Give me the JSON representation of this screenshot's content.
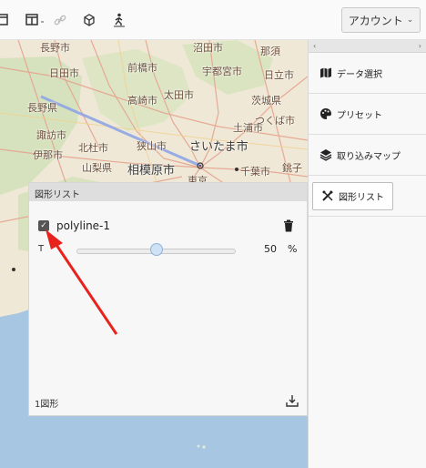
{
  "toolbar": {
    "icons": [
      "window-icon",
      "split-view-icon",
      "link-icon",
      "cube-icon",
      "person-walk-icon"
    ],
    "account_label": "アカウント",
    "account_chevron": "⌄"
  },
  "map": {
    "labels": [
      "長野市",
      "沼田市",
      "前橋市",
      "宇都宮市",
      "日立市",
      "那須",
      "日田市",
      "高崎市",
      "太田市",
      "茨城県",
      "長野県",
      "土浦市",
      "つくば市",
      "諏訪市",
      "伊那市",
      "北杜市",
      "山梨県",
      "狭山市",
      "相模原市",
      "さいたま市",
      "千葉市",
      "東京",
      "銚子"
    ],
    "line_color": "#8ea5e6"
  },
  "shape_panel": {
    "title": "図形リスト",
    "shape_name": "polyline-1",
    "t_label": "T",
    "opacity_value": "50",
    "opacity_fraction": 0.5,
    "opacity_unit": "%",
    "count_label": "1図形"
  },
  "right_panel": {
    "collapse_left": "‹",
    "collapse_right": "›",
    "items": [
      {
        "label": "データ選択",
        "icon": "map-icon"
      },
      {
        "label": "プリセット",
        "icon": "palette-icon"
      },
      {
        "label": "取り込みマップ",
        "icon": "layers-icon"
      },
      {
        "label": "図形リスト",
        "icon": "draw-tools-icon"
      }
    ]
  },
  "annotation": {
    "color": "#e8231d"
  }
}
